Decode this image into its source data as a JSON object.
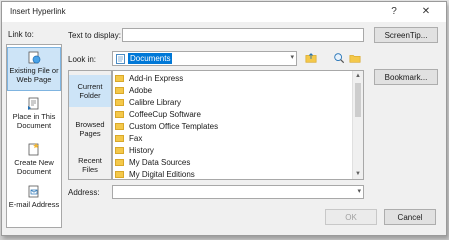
{
  "dialog": {
    "title": "Insert Hyperlink",
    "help_glyph": "?",
    "close_glyph": "✕"
  },
  "link_to": {
    "label": "Link to:",
    "items": [
      {
        "label": "Existing File or Web Page",
        "icon": "globe-page-icon",
        "selected": true
      },
      {
        "label": "Place in This Document",
        "icon": "document-place-icon",
        "selected": false
      },
      {
        "label": "Create New Document",
        "icon": "new-document-icon",
        "selected": false
      },
      {
        "label": "E-mail Address",
        "icon": "email-icon",
        "selected": false
      }
    ]
  },
  "text_to_display": {
    "label": "Text to display:",
    "value": ""
  },
  "buttons": {
    "screentip": "ScreenTip...",
    "bookmark": "Bookmark...",
    "ok": "OK",
    "cancel": "Cancel"
  },
  "look_in": {
    "label": "Look in:",
    "value": "Documents"
  },
  "side_tabs": [
    {
      "label": "Current Folder",
      "selected": true
    },
    {
      "label": "Browsed Pages",
      "selected": false
    },
    {
      "label": "Recent Files",
      "selected": false
    }
  ],
  "files": [
    {
      "name": "Add-in Express",
      "icon": "folder-icon"
    },
    {
      "name": "Adobe",
      "icon": "folder-icon"
    },
    {
      "name": "Calibre Library",
      "icon": "folder-icon"
    },
    {
      "name": "CoffeeCup Software",
      "icon": "folder-icon"
    },
    {
      "name": "Custom Office Templates",
      "icon": "folder-icon"
    },
    {
      "name": "Fax",
      "icon": "folder-icon"
    },
    {
      "name": "History",
      "icon": "folder-icon"
    },
    {
      "name": "My Data Sources",
      "icon": "data-folder-icon"
    },
    {
      "name": "My Digital Editions",
      "icon": "folder-icon"
    }
  ],
  "address": {
    "label": "Address:",
    "value": ""
  },
  "colors": {
    "accent": "#0078d7",
    "selection": "#cde4f7",
    "folder": "#f4c84a"
  }
}
